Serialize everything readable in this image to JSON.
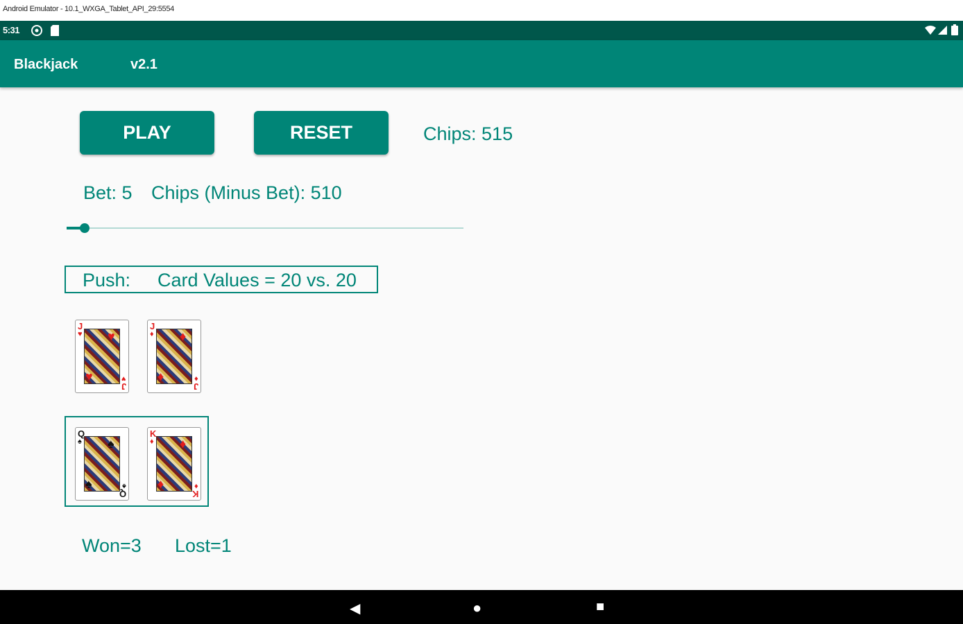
{
  "window": {
    "title": "Android Emulator - 10.1_WXGA_Tablet_API_29:5554"
  },
  "status_bar": {
    "time": "5:31",
    "icons": [
      "settings-icon",
      "sd-card-icon",
      "wifi-icon",
      "signal-icon",
      "battery-icon"
    ]
  },
  "app_bar": {
    "title": "Blackjack",
    "version": "v2.1"
  },
  "controls": {
    "play_label": "PLAY",
    "reset_label": "RESET",
    "chips_text": "Chips: 515"
  },
  "bet": {
    "bet_text": "Bet: 5",
    "chips_minus_bet_text": "Chips (Minus Bet): 510",
    "slider_fraction": 0.045
  },
  "result": {
    "outcome": "Push:",
    "card_values": "Card Values = 20 vs. 20"
  },
  "dealer_hand": [
    {
      "rank": "J",
      "suit": "♥",
      "color": "red"
    },
    {
      "rank": "J",
      "suit": "♦",
      "color": "red"
    }
  ],
  "player_hand": [
    {
      "rank": "Q",
      "suit": "♠",
      "color": "black"
    },
    {
      "rank": "K",
      "suit": "♦",
      "color": "red"
    }
  ],
  "record": {
    "won": "Won=3",
    "lost": "Lost=1"
  },
  "nav": {
    "back": "◀",
    "home": "●",
    "recents": "■"
  },
  "colors": {
    "primary": "#008577",
    "primary_dark": "#00574b",
    "accent_track": "#b3dad5"
  }
}
